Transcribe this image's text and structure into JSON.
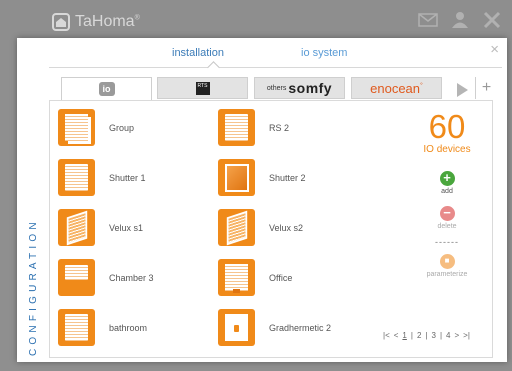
{
  "app": {
    "name": "TaHoma",
    "trademark": "®"
  },
  "dialog": {
    "close_label": "×",
    "tabs": [
      {
        "label": "installation"
      },
      {
        "label": "io system"
      }
    ],
    "protocols": [
      {
        "label": "io"
      },
      {
        "label": "RTS"
      },
      {
        "prefix": "others",
        "label": "somfy"
      },
      {
        "label": "enocean",
        "trademark": "°"
      }
    ],
    "add_protocol_label": "+",
    "section_label": "CONFIGURATION"
  },
  "devices": [
    {
      "name": "Group",
      "icon": "group-shutter-icon"
    },
    {
      "name": "RS 2",
      "icon": "shutter-icon"
    },
    {
      "name": "Shutter 1",
      "icon": "shutter-icon"
    },
    {
      "name": "Shutter 2",
      "icon": "window-icon"
    },
    {
      "name": "Velux s1",
      "icon": "roof-window-icon"
    },
    {
      "name": "Velux s2",
      "icon": "roof-window-icon"
    },
    {
      "name": "Chamber 3",
      "icon": "half-shutter-icon"
    },
    {
      "name": "Office",
      "icon": "shutter-door-icon"
    },
    {
      "name": "bathroom",
      "icon": "shutter-icon"
    },
    {
      "name": "Gradhermetic 2",
      "icon": "garage-icon"
    }
  ],
  "summary": {
    "count": "60",
    "label": "IO devices"
  },
  "actions": {
    "add": {
      "label": "add",
      "symbol": "+"
    },
    "delete": {
      "label": "delete",
      "symbol": "−"
    },
    "separator": "------",
    "parameterize": {
      "label": "parameterize",
      "symbol": "■"
    }
  },
  "pagination": {
    "first": "|<",
    "prev": "<",
    "pages": [
      "1",
      "2",
      "3",
      "4"
    ],
    "separator": "|",
    "next": ">",
    "last": ">|"
  },
  "colors": {
    "accent": "#f08a19",
    "link": "#3c7cb8",
    "add": "#4aa63d",
    "delete": "#e88a8a"
  }
}
